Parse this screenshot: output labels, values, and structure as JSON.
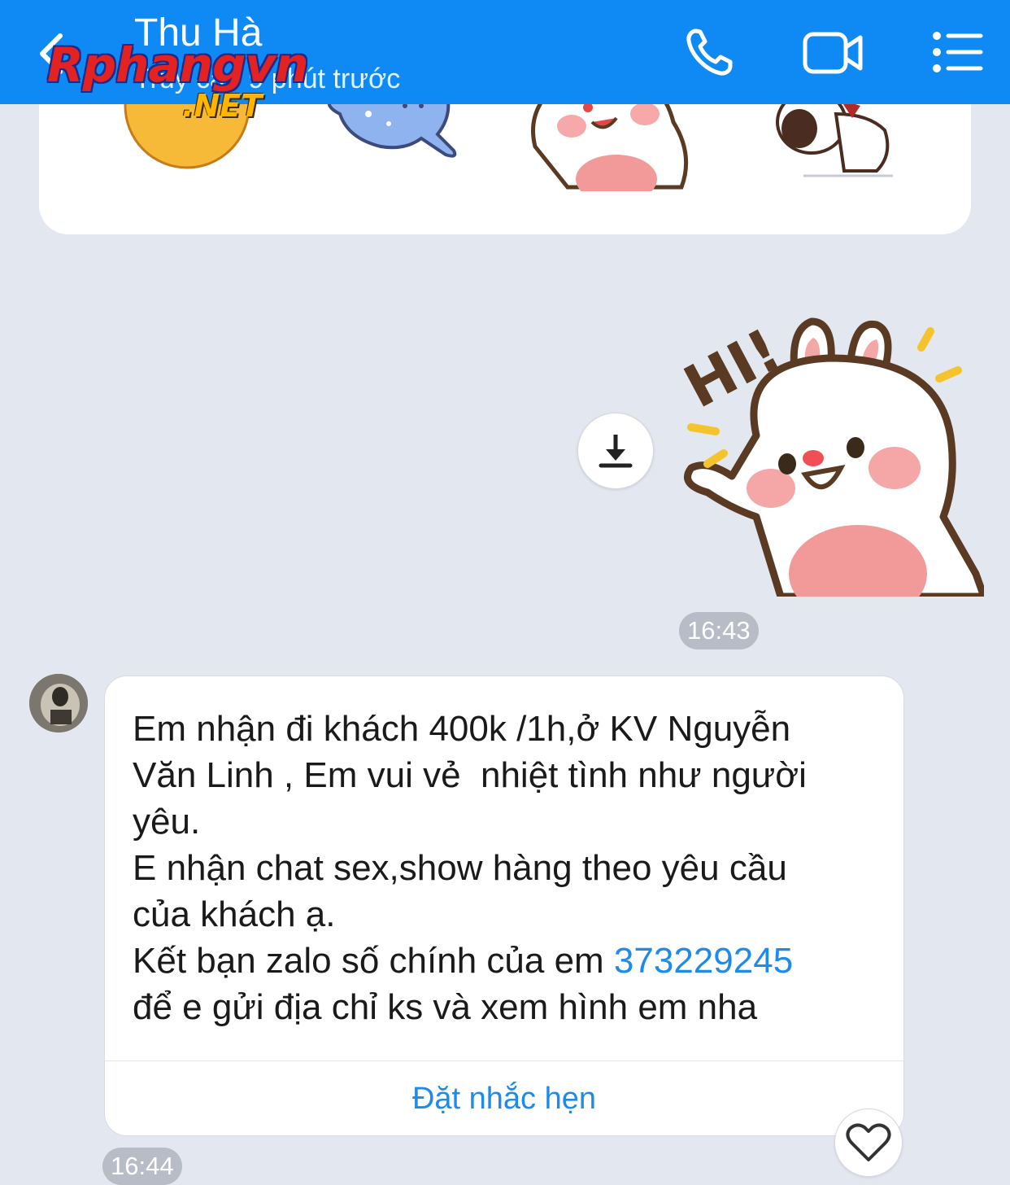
{
  "header": {
    "contact_name": "Thu Hà",
    "last_seen": "Truy cập 9 phút trước",
    "back_icon": "chevron-left-icon",
    "call_icon": "phone-icon",
    "video_icon": "video-camera-icon",
    "menu_icon": "list-menu-icon",
    "background": "#0f8af4"
  },
  "watermark": {
    "main": "Rphangvn",
    "suffix": ".NET"
  },
  "sticker_panel": {
    "stickers": [
      "emoji-face-sticker",
      "blue-cat-sticker",
      "bunny-sticker",
      "puppy-sticker"
    ]
  },
  "sent_sticker": {
    "text": "HI!",
    "download_icon": "download-icon",
    "time": "16:43"
  },
  "message": {
    "line1": "Em nhận đi khách 400k /1h,ở KV Nguyễn",
    "line2": "Văn Linh , Em vui vẻ  nhiệt tình như người",
    "line3": "yêu.",
    "line4": "E nhận chat sex,show hàng theo yêu cầu",
    "line5": "của khách ạ.",
    "line6_prefix": "Kết bạn zalo số chính của em ",
    "phone": "373229245",
    "line7": "để e gửi địa chỉ ks và xem hình em nha",
    "reminder_label": "Đặt nhắc hẹn",
    "time": "16:44",
    "like_icon": "heart-icon"
  },
  "colors": {
    "background": "#e3e7f0",
    "accent": "#1f8ae8"
  }
}
